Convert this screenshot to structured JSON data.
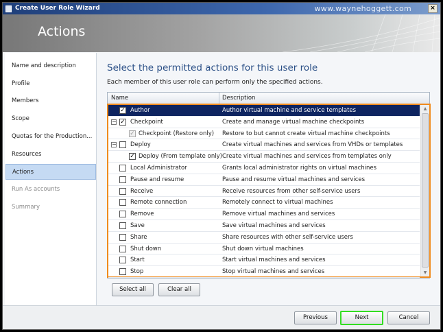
{
  "window": {
    "title": "Create User Role Wizard",
    "watermark": "www.waynehoggett.com",
    "close": "×"
  },
  "banner": {
    "title": "Actions"
  },
  "sidebar": {
    "items": [
      {
        "label": "Name and description",
        "state": "normal"
      },
      {
        "label": "Profile",
        "state": "normal"
      },
      {
        "label": "Members",
        "state": "normal"
      },
      {
        "label": "Scope",
        "state": "normal"
      },
      {
        "label": "Quotas for the Production...",
        "state": "normal"
      },
      {
        "label": "Resources",
        "state": "normal"
      },
      {
        "label": "Actions",
        "state": "selected"
      },
      {
        "label": "Run As accounts",
        "state": "disabled"
      },
      {
        "label": "Summary",
        "state": "disabled"
      }
    ]
  },
  "main": {
    "heading": "Select the permitted actions for this user role",
    "subtitle": "Each member of this user role can perform only the specified actions.",
    "columns": {
      "name": "Name",
      "description": "Description"
    },
    "rows": [
      {
        "name": "Author",
        "description": "Author virtual machine and service templates",
        "checked": true,
        "level": 0,
        "expander": false,
        "selected": true
      },
      {
        "name": "Checkpoint",
        "description": "Create and manage virtual machine checkpoints",
        "checked": true,
        "level": 0,
        "expander": true
      },
      {
        "name": "Checkpoint (Restore only)",
        "description": "Restore to but cannot create virtual machine checkpoints",
        "checked": true,
        "level": 1,
        "dim": true
      },
      {
        "name": "Deploy",
        "description": "Create virtual machines and services from VHDs or templates",
        "checked": false,
        "level": 0,
        "expander": true
      },
      {
        "name": "Deploy (From template only)",
        "description": "Create virtual machines and services from templates only",
        "checked": true,
        "level": 1
      },
      {
        "name": "Local Administrator",
        "description": "Grants local administrator rights on virtual machines",
        "checked": false,
        "level": 0
      },
      {
        "name": "Pause and resume",
        "description": "Pause and resume virtual machines and services",
        "checked": false,
        "level": 0
      },
      {
        "name": "Receive",
        "description": "Receive resources from other self-service users",
        "checked": false,
        "level": 0
      },
      {
        "name": "Remote connection",
        "description": "Remotely connect to virtual machines",
        "checked": false,
        "level": 0
      },
      {
        "name": "Remove",
        "description": "Remove virtual machines and services",
        "checked": false,
        "level": 0
      },
      {
        "name": "Save",
        "description": "Save virtual machines and services",
        "checked": false,
        "level": 0
      },
      {
        "name": "Share",
        "description": "Share resources with other self-service users",
        "checked": false,
        "level": 0
      },
      {
        "name": "Shut down",
        "description": "Shut down virtual machines",
        "checked": false,
        "level": 0
      },
      {
        "name": "Start",
        "description": "Start virtual machines and services",
        "checked": false,
        "level": 0
      },
      {
        "name": "Stop",
        "description": "Stop virtual machines and services",
        "checked": false,
        "level": 0
      }
    ],
    "select_all": "Select all",
    "clear_all": "Clear all"
  },
  "footer": {
    "previous": "Previous",
    "next": "Next",
    "cancel": "Cancel"
  }
}
